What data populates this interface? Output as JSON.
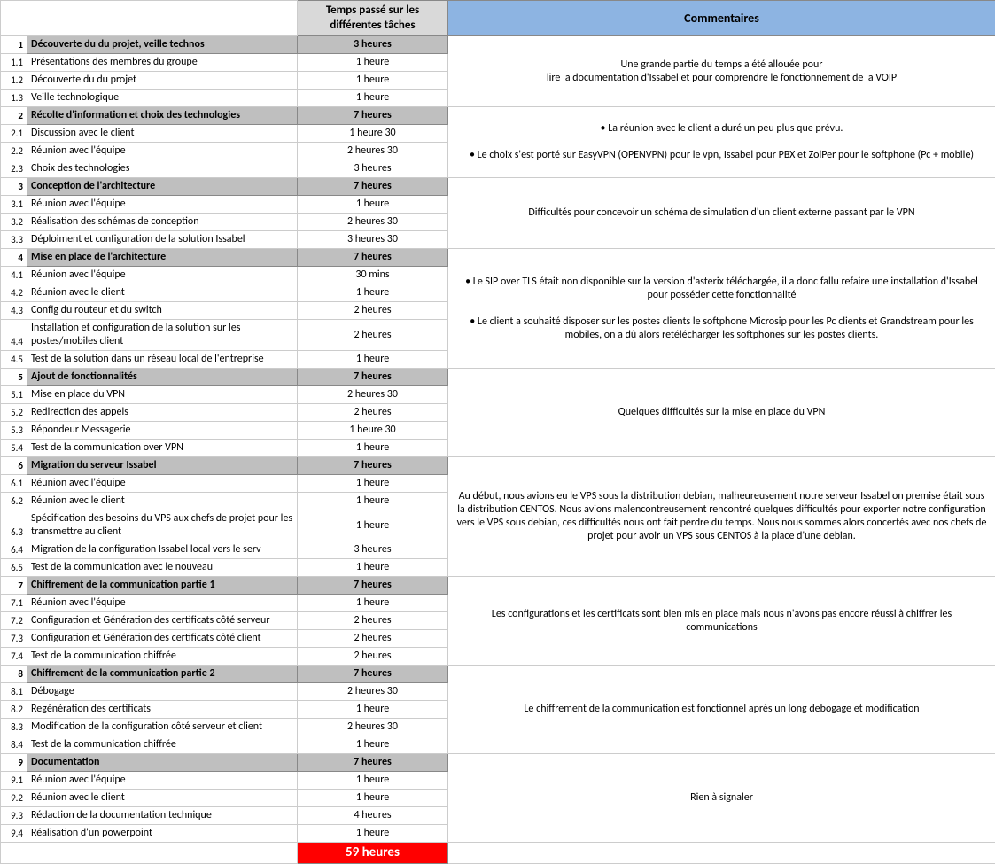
{
  "headers": {
    "time": "Temps passé sur les différentes tâches",
    "comment": "Commentaires"
  },
  "sections": [
    {
      "num": "1",
      "title": "Découverte du du projet, veille technos",
      "time": "3 heures",
      "comment": "Une grande partie du temps a été allouée pour\nlire la documentation d'Issabel et pour comprendre le fonctionnement de la VOIP",
      "rows": [
        {
          "num": "1.1",
          "task": "Présentations des membres du groupe",
          "time": "1 heure"
        },
        {
          "num": "1.2",
          "task": "Découverte du du projet",
          "time": "1 heure"
        },
        {
          "num": "1.3",
          "task": "Veille technologique",
          "time": "1 heure"
        }
      ]
    },
    {
      "num": "2",
      "title": "Récolte d'information et choix des technologies",
      "time": "7 heures",
      "comment": "• La réunion avec le client a duré un peu plus que prévu.\n\n• Le choix s'est porté sur EasyVPN (OPENVPN) pour le vpn, Issabel pour PBX et ZoiPer pour le softphone (Pc + mobile)",
      "rows": [
        {
          "num": "2.1",
          "task": "Discussion avec le client",
          "time": "1 heure 30"
        },
        {
          "num": "2.2",
          "task": "Réunion avec l'équipe",
          "time": "2 heures 30"
        },
        {
          "num": "2.3",
          "task": "Choix des technologies",
          "time": "3 heures"
        }
      ]
    },
    {
      "num": "3",
      "title": "Conception de l'architecture",
      "time": "7 heures",
      "comment": "Difficultés pour concevoir un schéma de simulation d'un client externe passant par le VPN",
      "rows": [
        {
          "num": "3.1",
          "task": "Réunion avec l'équipe",
          "time": "1 heure"
        },
        {
          "num": "3.2",
          "task": "Réalisation des schémas de conception",
          "time": "2 heures 30"
        },
        {
          "num": "3.3",
          "task": "Déploiment et configuration de la solution Issabel",
          "time": "3 heures 30"
        }
      ]
    },
    {
      "num": "4",
      "title": "Mise en place de l'architecture",
      "time": "7 heures",
      "comment": "• Le SIP over TLS était non disponible sur la version d'asterix téléchargée, il a donc fallu refaire une installation d'Issabel pour posséder cette fonctionnalité\n\n• Le client a souhaité disposer sur les postes clients le softphone Microsip pour les Pc clients et Grandstream pour les mobiles, on a dû alors retélécharger les softphones sur les postes clients.",
      "rows": [
        {
          "num": "4.1",
          "task": "Réunion avec l'équipe",
          "time": "30 mins"
        },
        {
          "num": "4.2",
          "task": "Réunion avec le client",
          "time": "1 heure"
        },
        {
          "num": "4.3",
          "task": "Config du routeur et du switch",
          "time": "2 heures"
        },
        {
          "num": "4.4",
          "task": "Installation et configuration de la solution sur les postes/mobiles client",
          "time": "2 heures",
          "tall": true
        },
        {
          "num": "4.5",
          "task": "Test de la solution dans un réseau local de l'entreprise",
          "time": "1 heure"
        }
      ]
    },
    {
      "num": "5",
      "title": "Ajout de fonctionnalités",
      "time": "7 heures",
      "comment": "Quelques difficultés sur la mise en place du VPN",
      "rows": [
        {
          "num": "5.1",
          "task": "Mise en place du VPN",
          "time": "2 heures 30"
        },
        {
          "num": "5.2",
          "task": "Redirection des appels",
          "time": "2 heures"
        },
        {
          "num": "5.3",
          "task": "Répondeur Messagerie",
          "time": "1 heure 30"
        },
        {
          "num": "5.4",
          "task": "Test de la communication over VPN",
          "time": "1 heure"
        }
      ]
    },
    {
      "num": "6",
      "title": "Migration du serveur Issabel",
      "time": "7 heures",
      "comment": "Au début, nous avions eu le VPS sous la distribution debian, malheureusement notre serveur Issabel on premise était sous la distribution CENTOS. Nous avions malencontreusement rencontré quelques difficultés pour exporter notre configuration vers le VPS sous debian, ces difficultés nous ont fait perdre du temps. Nous nous sommes alors concertés avec nos chefs de projet pour avoir un VPS sous CENTOS à la place d'une debian.",
      "rows": [
        {
          "num": "6.1",
          "task": "Réunion avec l'équipe",
          "time": "1 heure"
        },
        {
          "num": "6.2",
          "task": "Réunion avec le client",
          "time": "1 heure"
        },
        {
          "num": "6.3",
          "task": "Spécification des besoins du VPS aux chefs de projet pour les transmettre au client",
          "time": "1 heure",
          "tall": true
        },
        {
          "num": "6.4",
          "task": "Migration de la configuration Issabel local vers le serv",
          "time": "3 heures"
        },
        {
          "num": "6.5",
          "task": "Test de la communication avec le nouveau",
          "time": "1 heure"
        }
      ]
    },
    {
      "num": "7",
      "title": "Chiffrement de la communication partie 1",
      "time": "7 heures",
      "comment": "Les configurations et les certificats sont bien mis en place mais nous n'avons pas encore réussi à chiffrer les communications",
      "rows": [
        {
          "num": "7.1",
          "task": "Réunion avec l'équipe",
          "time": "1 heure"
        },
        {
          "num": "7.2",
          "task": "Configuration et Génération des certificats côté serveur",
          "time": "2 heures"
        },
        {
          "num": "7.3",
          "task": "Configuration et Génération des certificats côté client",
          "time": "2 heures"
        },
        {
          "num": "7.4",
          "task": "Test de la communication chiffrée",
          "time": "2 heures"
        }
      ]
    },
    {
      "num": "8",
      "title": "Chiffrement de la communication partie 2",
      "time": "7 heures",
      "comment": "Le chiffrement de la communication est fonctionnel après un long debogage et modification",
      "rows": [
        {
          "num": "8.1",
          "task": "Débogage",
          "time": "2 heures 30"
        },
        {
          "num": "8.2",
          "task": "Regénération des certificats",
          "time": "1 heure"
        },
        {
          "num": "8.3",
          "task": "Modification de la configuration côté serveur et client",
          "time": "2 heures 30"
        },
        {
          "num": "8.4",
          "task": "Test de la communication chiffrée",
          "time": "1 heure"
        }
      ]
    },
    {
      "num": "9",
      "title": "Documentation",
      "time": "7 heures",
      "comment": "Rien à signaler",
      "rows": [
        {
          "num": "9.1",
          "task": "Réunion avec l'équipe",
          "time": "1 heure"
        },
        {
          "num": "9.2",
          "task": "Réunion avec le client",
          "time": "1 heure"
        },
        {
          "num": "9.3",
          "task": "Rédaction de la documentation technique",
          "time": "4 heures"
        },
        {
          "num": "9.4",
          "task": "Réalisation d'un powerpoint",
          "time": "1 heure"
        }
      ]
    }
  ],
  "total": "59 heures"
}
